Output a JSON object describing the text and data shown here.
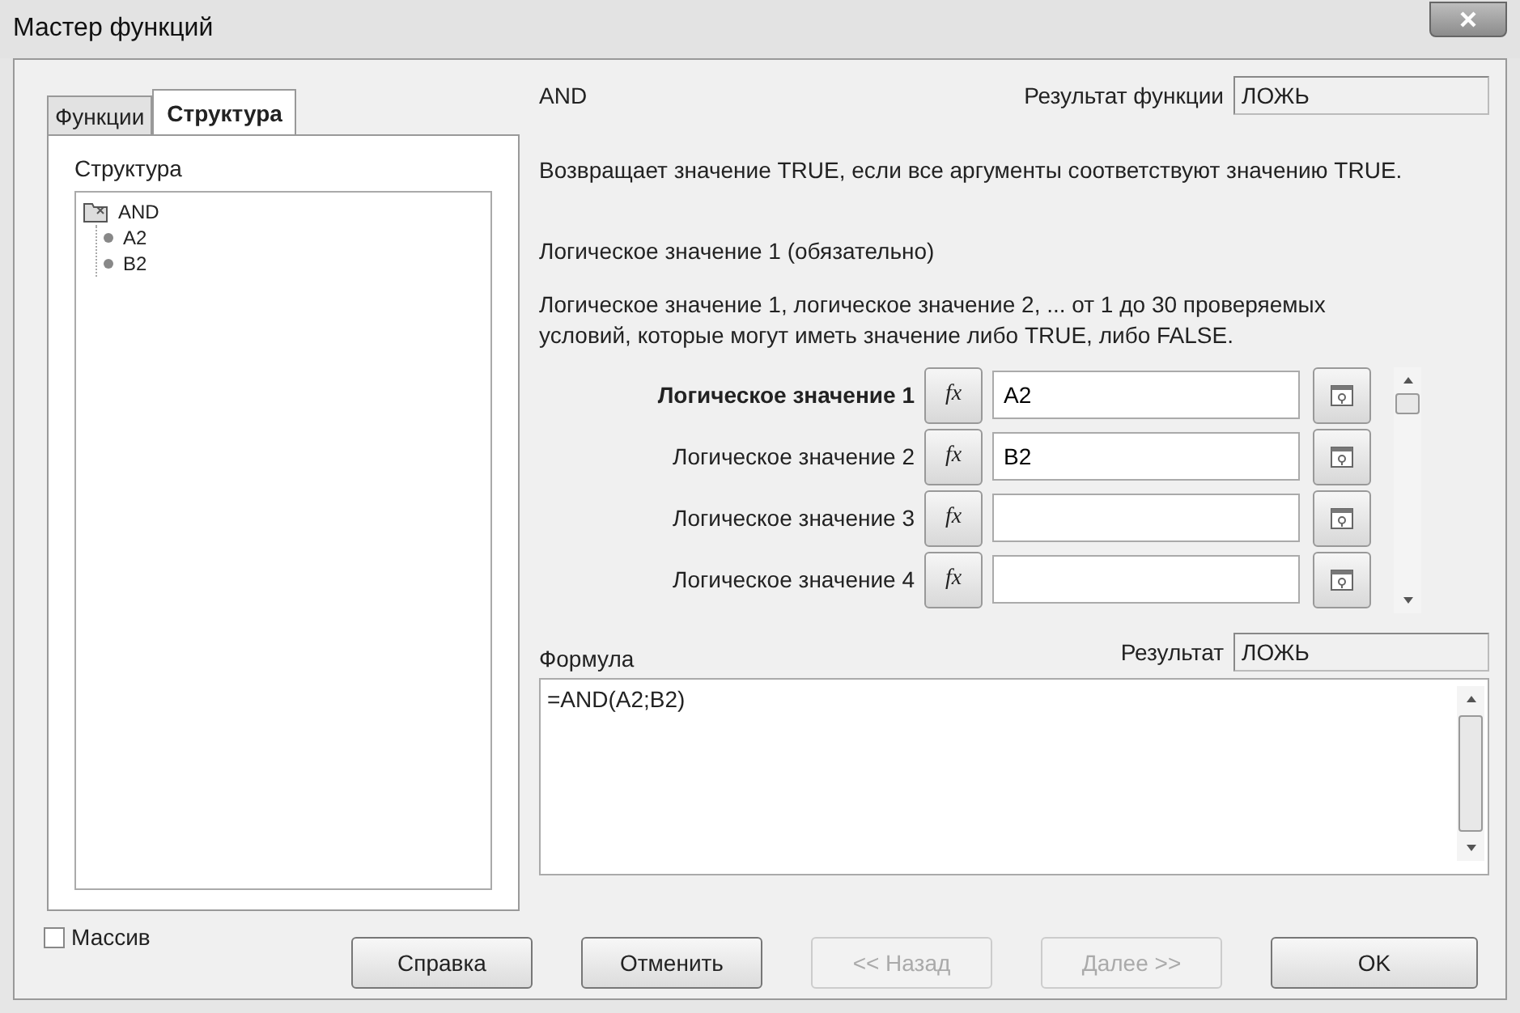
{
  "window": {
    "title": "Мастер функций"
  },
  "tabs": [
    {
      "label": "Функции",
      "selected": false
    },
    {
      "label": "Структура",
      "selected": true
    }
  ],
  "structure": {
    "label": "Структура",
    "tree": [
      {
        "label": "AND",
        "kind": "function",
        "children": [
          {
            "label": "A2",
            "kind": "value"
          },
          {
            "label": "B2",
            "kind": "value"
          }
        ]
      }
    ]
  },
  "function": {
    "name": "AND",
    "result_label": "Результат функции",
    "result": "ЛОЖЬ",
    "description": "Возвращает значение TRUE, если все аргументы соответствуют значению TRUE.",
    "argument_title": "Логическое значение 1 (обязательно)",
    "argument_description": "Логическое значение 1, логическое значение 2, ... от 1 до 30 проверяемых условий, которые могут иметь значение либо TRUE, либо FALSE."
  },
  "arguments": [
    {
      "label": "Логическое значение 1",
      "button": "fx",
      "value": "A2",
      "selected": true
    },
    {
      "label": "Логическое значение 2",
      "button": "fx",
      "value": "B2",
      "selected": false
    },
    {
      "label": "Логическое значение 3",
      "button": "fx",
      "selected": false
    },
    {
      "label": "Логическое значение 4",
      "button": "fx",
      "selected": false
    }
  ],
  "formula": {
    "label": "Формула",
    "value": "=AND(A2;B2)",
    "result_label": "Результат",
    "result": "ЛОЖЬ"
  },
  "array": {
    "label": "Массив",
    "checked": false
  },
  "buttons": [
    {
      "label": "Справка",
      "disabled": false
    },
    {
      "label": "Отменить",
      "disabled": false
    },
    {
      "label": "<< Назад",
      "disabled": true
    },
    {
      "label": "Далее >>",
      "disabled": true
    },
    {
      "label": "OK",
      "disabled": false
    }
  ]
}
